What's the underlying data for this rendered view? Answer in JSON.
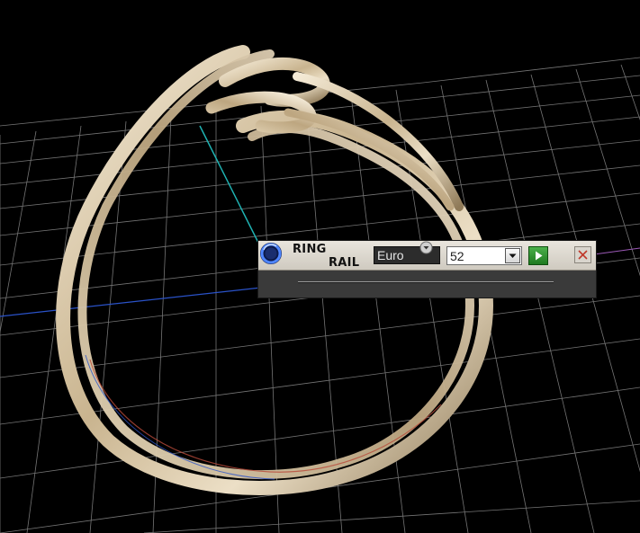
{
  "panel": {
    "title_line1": "RING",
    "title_line2": "RAIL",
    "standard_value": "Euro",
    "size_value": "52",
    "slider_level": 0.5
  },
  "icons": {
    "logo": "ring-logo-icon",
    "dropdown": "chevron-down-icon",
    "play": "play-icon",
    "close": "close-icon",
    "slider_thumb": "slider-thumb-icon"
  },
  "colors": {
    "background": "#000000",
    "grid": "#8a8a8a",
    "ring_metal": "#d8c9ad",
    "axis_blue": "#2a52c8",
    "guide_teal": "#1fb3b3",
    "play_green": "#2f9a2f",
    "close_red": "#c0392b"
  }
}
